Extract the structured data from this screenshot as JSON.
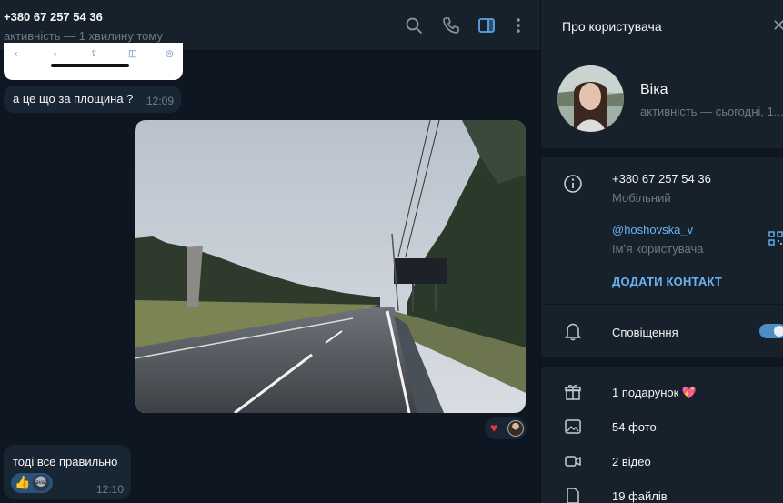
{
  "chat": {
    "title": "+380 67 257 54 36",
    "status": "активність — 1 хвилину тому",
    "messages": [
      {
        "text": "а це що за площина ?",
        "time": "12:09"
      },
      {
        "text": "тоді все правильно",
        "time": "12:10"
      }
    ],
    "photo_reactions": {
      "emoji": "♥"
    },
    "message_reaction": {
      "emoji": "👍",
      "avatar_text": "avat"
    }
  },
  "profile": {
    "title": "Про користувача",
    "close_glyph": "✕",
    "name": "Віка",
    "last_seen": "активність — сьогодні, 1...",
    "phone": "+380 67 257 54 36",
    "phone_label": "Мобільний",
    "username": "@hoshovska_v",
    "username_label": "Імʼя користувача",
    "add_contact": "ДОДАТИ КОНТАКТ",
    "notifications_label": "Сповіщення",
    "notifications_on": true,
    "media": [
      {
        "label": "1 подарунок 💖",
        "icon": "gift-icon"
      },
      {
        "label": "54 фото",
        "icon": "photo-icon"
      },
      {
        "label": "2 відео",
        "icon": "video-icon"
      },
      {
        "label": "19 файлів",
        "icon": "file-icon"
      }
    ]
  },
  "colors": {
    "chat_bg": "#0e1621",
    "panel_bg": "#17212b",
    "bubble_in": "#182533",
    "accent": "#6ab3f3",
    "muted": "#6c7883"
  }
}
